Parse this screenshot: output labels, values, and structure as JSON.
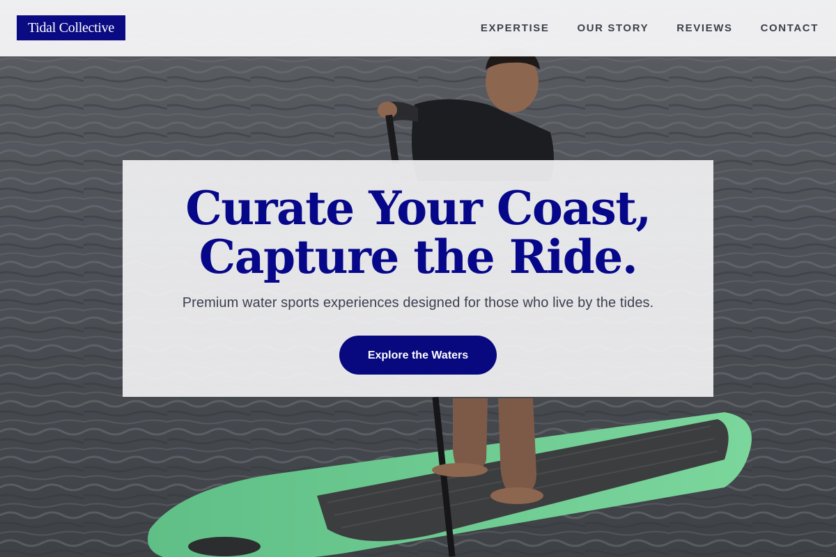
{
  "header": {
    "logo_text": "Tidal Collective",
    "nav": [
      {
        "label": "EXPERTISE"
      },
      {
        "label": "OUR STORY"
      },
      {
        "label": "REVIEWS"
      },
      {
        "label": "CONTACT"
      }
    ]
  },
  "hero": {
    "title_line1": "Curate Your Coast,",
    "title_line2": "Capture the Ride.",
    "subtitle": "Premium water sports experiences designed for those who live by the tides.",
    "cta_label": "Explore the Waters",
    "background_image": "paddleboarder-on-water-photo"
  },
  "colors": {
    "brand": "#0a0a82",
    "nav_text": "#3b3f4a",
    "subtitle_text": "#3a3f4d",
    "board_green": "#6fcf8e"
  }
}
